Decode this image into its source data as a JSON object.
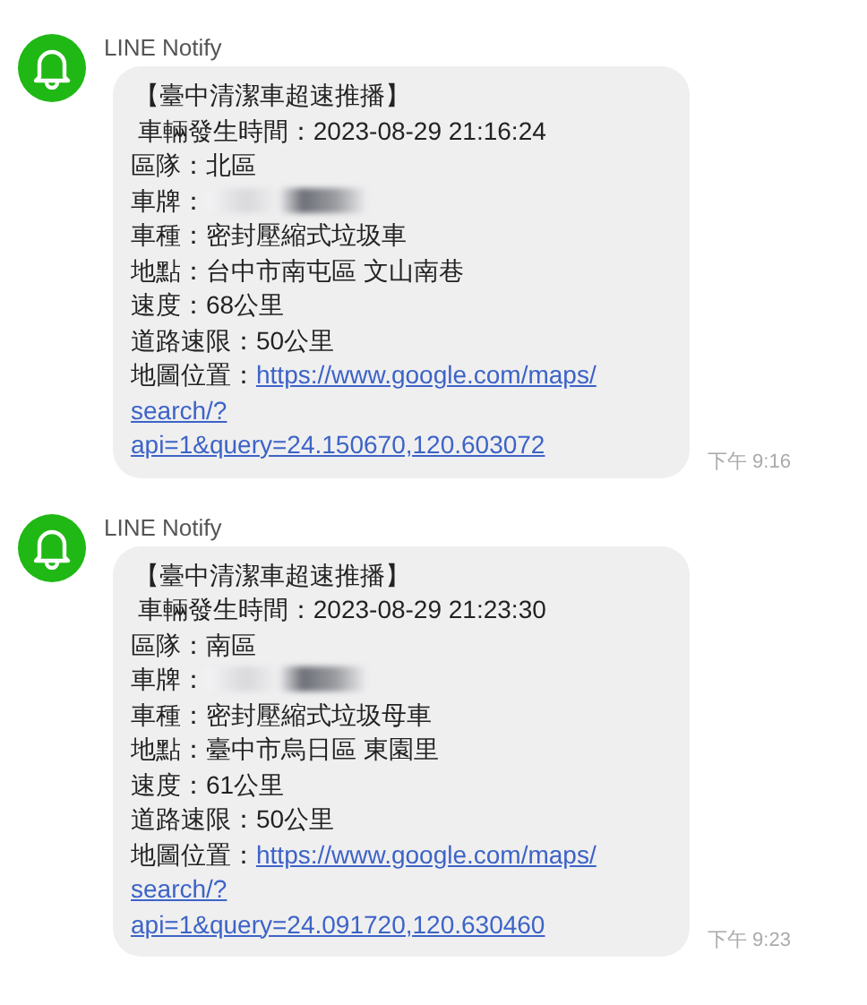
{
  "messages": [
    {
      "sender": "LINE Notify",
      "time": "下午 9:16",
      "title": "【臺中清潔車超速推播】",
      "rows": [
        {
          "kind": "text",
          "label": " 車輛發生時間：",
          "value": "2023-08-29 21:16:24"
        },
        {
          "kind": "text",
          "label": "區隊：",
          "value": "北區"
        },
        {
          "kind": "redacted",
          "label": "車牌："
        },
        {
          "kind": "text",
          "label": "車種：",
          "value": "密封壓縮式垃圾車"
        },
        {
          "kind": "text",
          "label": "地點：",
          "value": "台中市南屯區 文山南巷"
        },
        {
          "kind": "text",
          "label": "速度：",
          "value": "68公里"
        },
        {
          "kind": "text",
          "label": "道路速限：",
          "value": "50公里"
        },
        {
          "kind": "link",
          "label": "地圖位置：",
          "link_lines": [
            "https://www.google.com/maps/",
            "search/?",
            "api=1&query=24.150670,120.603072"
          ]
        }
      ]
    },
    {
      "sender": "LINE Notify",
      "time": "下午 9:23",
      "title": "【臺中清潔車超速推播】",
      "rows": [
        {
          "kind": "text",
          "label": " 車輛發生時間：",
          "value": "2023-08-29 21:23:30"
        },
        {
          "kind": "text",
          "label": "區隊：",
          "value": "南區"
        },
        {
          "kind": "redacted",
          "label": "車牌："
        },
        {
          "kind": "text",
          "label": "車種：",
          "value": "密封壓縮式垃圾母車"
        },
        {
          "kind": "text",
          "label": "地點：",
          "value": "臺中市烏日區 東園里"
        },
        {
          "kind": "text",
          "label": "速度：",
          "value": "61公里"
        },
        {
          "kind": "text",
          "label": "道路速限：",
          "value": "50公里"
        },
        {
          "kind": "link",
          "label": "地圖位置：",
          "link_lines": [
            "https://www.google.com/maps/",
            "search/?",
            "api=1&query=24.091720,120.630460"
          ]
        }
      ]
    }
  ]
}
